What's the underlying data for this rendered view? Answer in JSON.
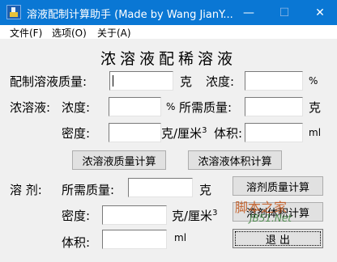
{
  "window": {
    "title": "溶液配制计算助手 (Made by Wang JianY...",
    "minimize_glyph": "—",
    "maximize_glyph": "☐",
    "close_glyph": "✕"
  },
  "menu": [
    "文件(F)",
    "选项(O)",
    "关于(A)"
  ],
  "heading": "浓溶液配稀溶液",
  "row1": {
    "label": "配制溶液质量:",
    "mass_value": "",
    "mass_unit": "克",
    "conc_label": "浓度:",
    "conc_value": "",
    "conc_unit": "%"
  },
  "concentrated": {
    "label": "浓溶液:",
    "conc_label": "浓度:",
    "conc_value": "",
    "conc_unit": "%",
    "mass_label": "所需质量:",
    "mass_value": "",
    "mass_unit": "克",
    "density_label": "密度:",
    "density_value": "",
    "density_unit": "克/厘米",
    "density_exp": "3",
    "volume_label": "体积:",
    "volume_value": "",
    "volume_unit": "ml"
  },
  "buttons": {
    "calc_mass": "浓溶液质量计算",
    "calc_volume": "浓溶液体积计算",
    "solvent_mass": "溶剂质量计算",
    "solvent_volume": "溶剂体积计算",
    "exit": "退  出"
  },
  "solvent": {
    "label": "溶 剂:",
    "mass_label": "所需质量:",
    "mass_value": "",
    "mass_unit": "克",
    "density_label": "密度:",
    "density_value": "",
    "density_unit": "克/厘米",
    "density_exp": "3",
    "volume_label": "体积:",
    "volume_value": "",
    "volume_unit": "ml"
  },
  "watermark": {
    "line1": "脚本之家",
    "line2": "JB51.Net"
  },
  "colors": {
    "titlebar": "#0a77d4",
    "client_bg": "#f0f0f0",
    "button_bg": "#e1e1e1"
  }
}
